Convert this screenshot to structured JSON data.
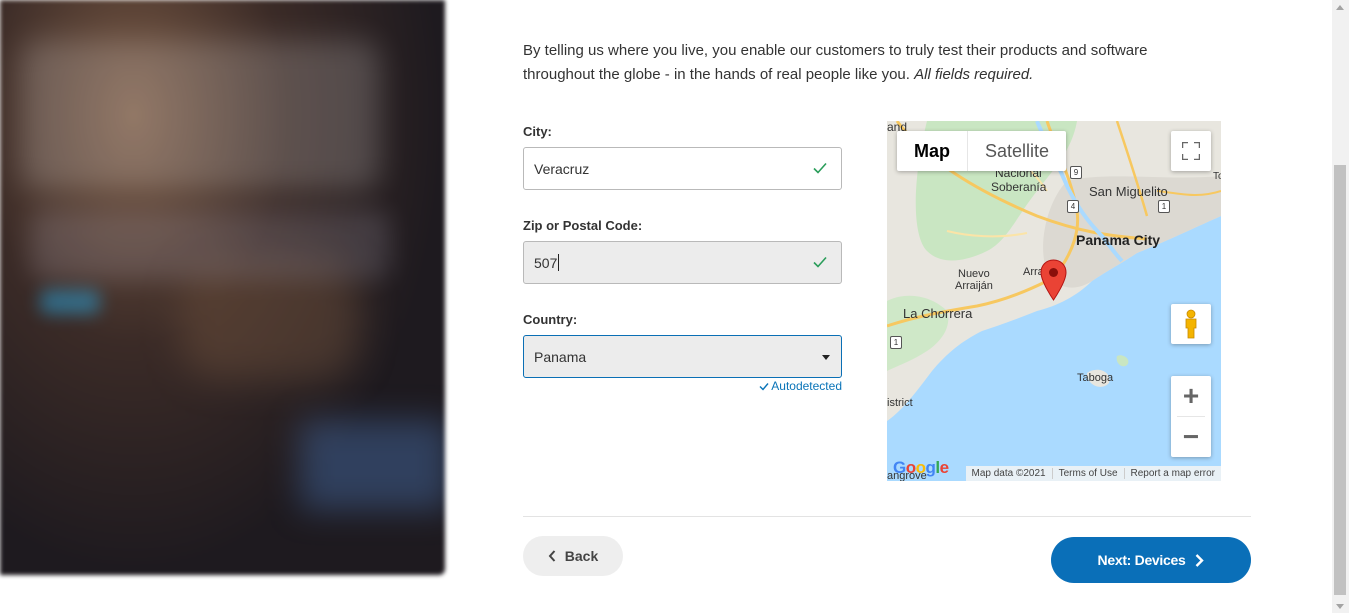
{
  "page": {
    "intro_text": "By telling us where you live, you enable our customers to truly test their products and software throughout the globe - in the hands of real people like you.",
    "intro_required": "All fields required."
  },
  "form": {
    "city": {
      "label": "City:",
      "value": "Veracruz",
      "valid": true
    },
    "zip": {
      "label": "Zip or Postal Code:",
      "value": "507",
      "valid": true
    },
    "country": {
      "label": "Country:",
      "value": "Panama",
      "note": "Autodetected"
    }
  },
  "map": {
    "type_map": "Map",
    "type_satellite": "Satellite",
    "zoom_in": "+",
    "zoom_out": "−",
    "places": {
      "nacional_soberania_1": "Nacional",
      "nacional_soberania_2": "Soberanía",
      "san_miguelito": "San Miguelito",
      "panama_city": "Panama City",
      "nuevo_arraijan_1": "Nuevo",
      "nuevo_arraijan_2": "Arraiján",
      "arraijan_cut": "Arrai",
      "la_chorrera": "La Chorrera",
      "taboga": "Taboga",
      "istrict": "istrict",
      "and": "and",
      "angrove": "angrove",
      "to": "To"
    },
    "shields": [
      "9",
      "4",
      "1",
      "1"
    ],
    "attribution": {
      "map_data": "Map data ©2021",
      "terms": "Terms of Use",
      "report": "Report a map error"
    },
    "logo": "Google",
    "colors": {
      "water": "#aadaff",
      "land": "#e8e6df",
      "park": "#c9e6c2",
      "road": "#f7c860"
    }
  },
  "nav": {
    "back_label": "Back",
    "next_label": "Next: Devices"
  },
  "colors": {
    "primary": "#0a6fb8",
    "valid": "#2a9d5a"
  }
}
